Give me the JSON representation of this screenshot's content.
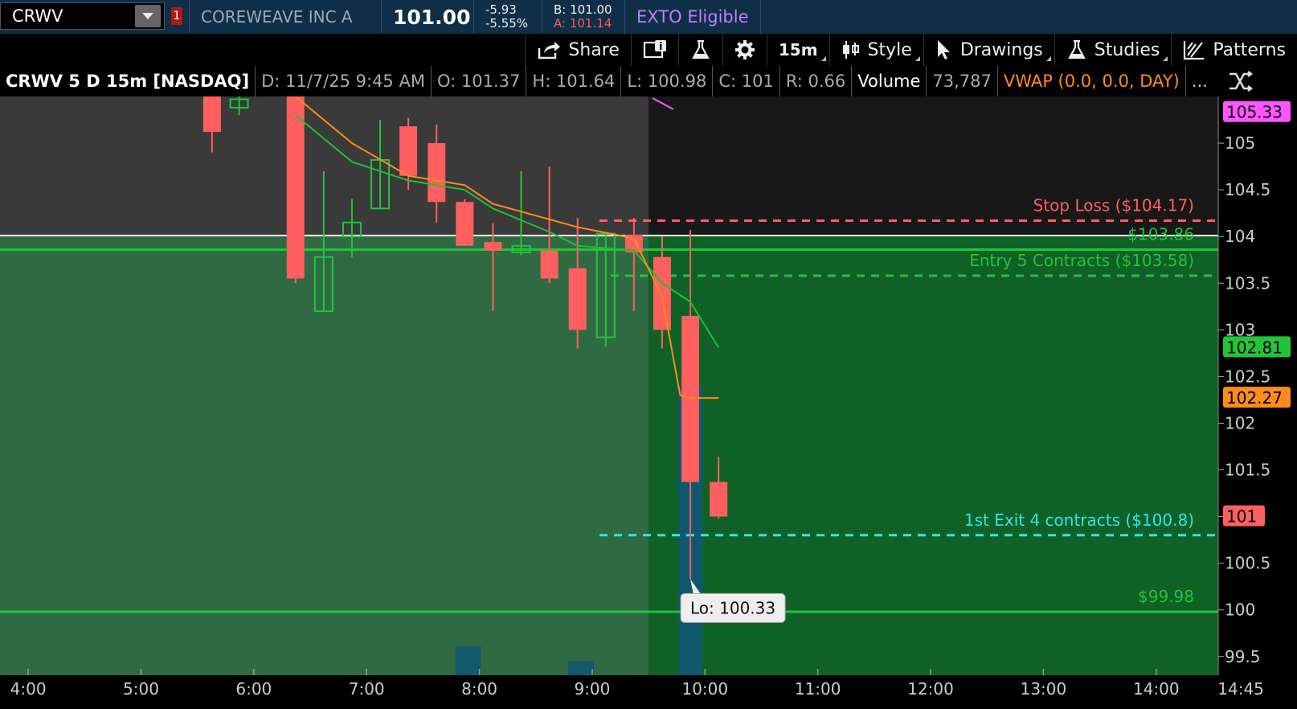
{
  "header": {
    "symbol": "CRWV",
    "alert_badge": "1",
    "company": "COREWEAVE INC A",
    "last_price": "101.00",
    "change": "-5.93",
    "change_pct": "-5.55%",
    "bid": "B: 101.00",
    "ask": "A: 101.14",
    "exto": "EXTO Eligible"
  },
  "toolbar": {
    "share": "Share",
    "timeframe": "15m",
    "style": "Style",
    "drawings": "Drawings",
    "studies": "Studies",
    "patterns": "Patterns"
  },
  "status": {
    "title": "CRWV 5 D 15m [NASDAQ]",
    "date": "D: 11/7/25 9:45 AM",
    "open": "O: 101.37",
    "high": "H: 101.64",
    "low": "L: 100.98",
    "close": "C: 101",
    "range": "R: 0.66",
    "volume_label": "Volume",
    "volume_value": "73,787",
    "vwap": "VWAP (0.0, 0.0, DAY)",
    "more": "..."
  },
  "colors": {
    "bull": "#22c43a",
    "bear": "#ff5f5f",
    "vwap": "#ff8c1a",
    "ema": "#1fbf3a",
    "stop": "#ff5f5f",
    "entry": "#22c43a",
    "exit": "#2ee6ee",
    "white_line": "#ffffff"
  },
  "chart_data": {
    "type": "candlestick",
    "time_unit": "hours",
    "y_range": [
      99.3,
      105.5
    ],
    "x_range": [
      3.75,
      14.55
    ],
    "y_ticks": [
      "99.5",
      "100",
      "100.5",
      "101",
      "101.5",
      "102",
      "102.5",
      "103",
      "103.5",
      "104",
      "104.5",
      "105"
    ],
    "x_ticks": [
      "4:00",
      "5:00",
      "6:00",
      "7:00",
      "8:00",
      "9:00",
      "10:00",
      "11:00",
      "12:00",
      "13:00",
      "14:00",
      "14:45"
    ],
    "candles": [
      {
        "t": 5.63,
        "o": 105.5,
        "h": 105.6,
        "l": 104.9,
        "c": 105.12
      },
      {
        "t": 5.87,
        "o": 105.38,
        "h": 105.6,
        "l": 105.3,
        "c": 105.47
      },
      {
        "t": 6.37,
        "o": 105.5,
        "h": 105.5,
        "l": 103.5,
        "c": 103.55
      },
      {
        "t": 6.62,
        "o": 103.2,
        "h": 104.7,
        "l": 103.2,
        "c": 103.78
      },
      {
        "t": 6.87,
        "o": 104.0,
        "h": 104.4,
        "l": 103.78,
        "c": 104.15
      },
      {
        "t": 7.12,
        "o": 104.3,
        "h": 105.25,
        "l": 104.3,
        "c": 104.82
      },
      {
        "t": 7.37,
        "o": 105.18,
        "h": 105.27,
        "l": 104.5,
        "c": 104.65
      },
      {
        "t": 7.62,
        "o": 105.0,
        "h": 105.2,
        "l": 104.15,
        "c": 104.37
      },
      {
        "t": 7.87,
        "o": 104.37,
        "h": 104.4,
        "l": 103.9,
        "c": 103.9
      },
      {
        "t": 8.12,
        "o": 103.94,
        "h": 104.14,
        "l": 103.2,
        "c": 103.85
      },
      {
        "t": 8.37,
        "o": 103.83,
        "h": 104.7,
        "l": 103.8,
        "c": 103.9
      },
      {
        "t": 8.62,
        "o": 103.85,
        "h": 104.75,
        "l": 103.5,
        "c": 103.55
      },
      {
        "t": 8.87,
        "o": 103.66,
        "h": 104.2,
        "l": 102.8,
        "c": 103.0
      },
      {
        "t": 9.12,
        "o": 102.92,
        "h": 104.05,
        "l": 102.82,
        "c": 104.03
      },
      {
        "t": 9.37,
        "o": 104.02,
        "h": 104.2,
        "l": 103.2,
        "c": 103.83
      },
      {
        "t": 9.62,
        "o": 103.78,
        "h": 104.0,
        "l": 102.8,
        "c": 103.0
      },
      {
        "t": 9.87,
        "o": 103.15,
        "h": 104.07,
        "l": 100.33,
        "c": 101.37
      },
      {
        "t": 10.12,
        "o": 101.37,
        "h": 101.64,
        "l": 100.98,
        "c": 101.0
      }
    ],
    "vwap_line": {
      "t": [
        6.37,
        6.87,
        7.37,
        7.87,
        8.12,
        8.87,
        9.37,
        9.62,
        9.78,
        9.87,
        10.12
      ],
      "v": [
        105.5,
        105.0,
        104.65,
        104.55,
        104.35,
        104.1,
        103.98,
        103.35,
        102.3,
        102.27,
        102.27
      ]
    },
    "ema_line": {
      "t": [
        6.37,
        6.87,
        7.37,
        7.87,
        8.12,
        8.62,
        8.87,
        9.37,
        9.62,
        9.87,
        10.12
      ],
      "v": [
        105.3,
        104.8,
        104.6,
        104.5,
        104.3,
        104.05,
        103.9,
        103.85,
        103.5,
        103.3,
        102.81
      ]
    },
    "volume": [
      {
        "t": 7.9,
        "v": 0.1
      },
      {
        "t": 8.9,
        "v": 0.05
      },
      {
        "t": 9.87,
        "v": 1.0
      }
    ],
    "levels": [
      {
        "label": "Stop Loss ($104.17)",
        "value": 104.17,
        "color": "#ff5f5f",
        "style": "dashed"
      },
      {
        "label": "$103.86",
        "value": 103.86,
        "color": "#22c43a",
        "style": "solid"
      },
      {
        "label": "Entry 5 Contracts ($103.58)",
        "value": 103.58,
        "color": "#22c43a",
        "style": "dashed"
      },
      {
        "label": "1st Exit 4 contracts ($100.8)",
        "value": 100.8,
        "color": "#2ee6ee",
        "style": "dashed"
      },
      {
        "label": "$99.98",
        "value": 99.98,
        "color": "#22c43a",
        "style": "solid"
      }
    ],
    "white_level": 104.01,
    "low_marker": {
      "label": "Lo: 100.33",
      "value": 100.33,
      "t": 9.87
    },
    "price_badges": [
      {
        "label": "105.33",
        "value": 105.33,
        "bg": "#ff55ff",
        "fg": "#000"
      },
      {
        "label": "102.81",
        "value": 102.81,
        "bg": "#22c43a",
        "fg": "#000"
      },
      {
        "label": "102.27",
        "value": 102.27,
        "bg": "#ff8c1a",
        "fg": "#000"
      },
      {
        "label": "101",
        "value": 101.0,
        "bg": "#ff5f5f",
        "fg": "#000"
      }
    ],
    "extended_hours_end": 9.5
  }
}
